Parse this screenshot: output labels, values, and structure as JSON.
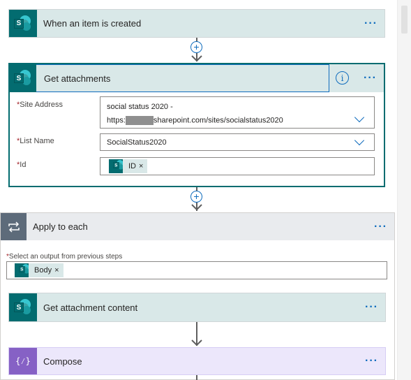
{
  "trigger": {
    "title": "When an item is created",
    "menu": "···"
  },
  "get_attachments": {
    "title": "Get attachments",
    "menu": "···",
    "info": "i",
    "fields": {
      "site_address": {
        "label": "Site Address",
        "required": "*",
        "line1": "social status 2020 -",
        "line2_prefix": "https:",
        "line2_suffix": "sharepoint.com/sites/socialstatus2020"
      },
      "list_name": {
        "label": "List Name",
        "required": "*",
        "value": "SocialStatus2020"
      },
      "id": {
        "label": "Id",
        "required": "*",
        "token": "ID"
      }
    }
  },
  "apply_to_each": {
    "title": "Apply to each",
    "menu": "···",
    "select_label": "Select an output from previous steps",
    "required": "*",
    "token": "Body"
  },
  "get_attachment_content": {
    "title": "Get attachment content",
    "menu": "···"
  },
  "compose": {
    "title": "Compose",
    "menu": "···",
    "icon_text": "{⁄}"
  },
  "plus_symbol": "+",
  "token_remove": "×",
  "sp_letter": "S",
  "icons": {
    "sharepoint": "sharepoint-icon",
    "loop": "loop-icon",
    "compose": "compose-icon",
    "info": "info-icon",
    "chevron": "chevron-down-icon"
  },
  "colors": {
    "sharepoint": "#036c70",
    "accent": "#0f6cbd",
    "compose": "#8661c5",
    "loop": "#5d6b7a"
  }
}
